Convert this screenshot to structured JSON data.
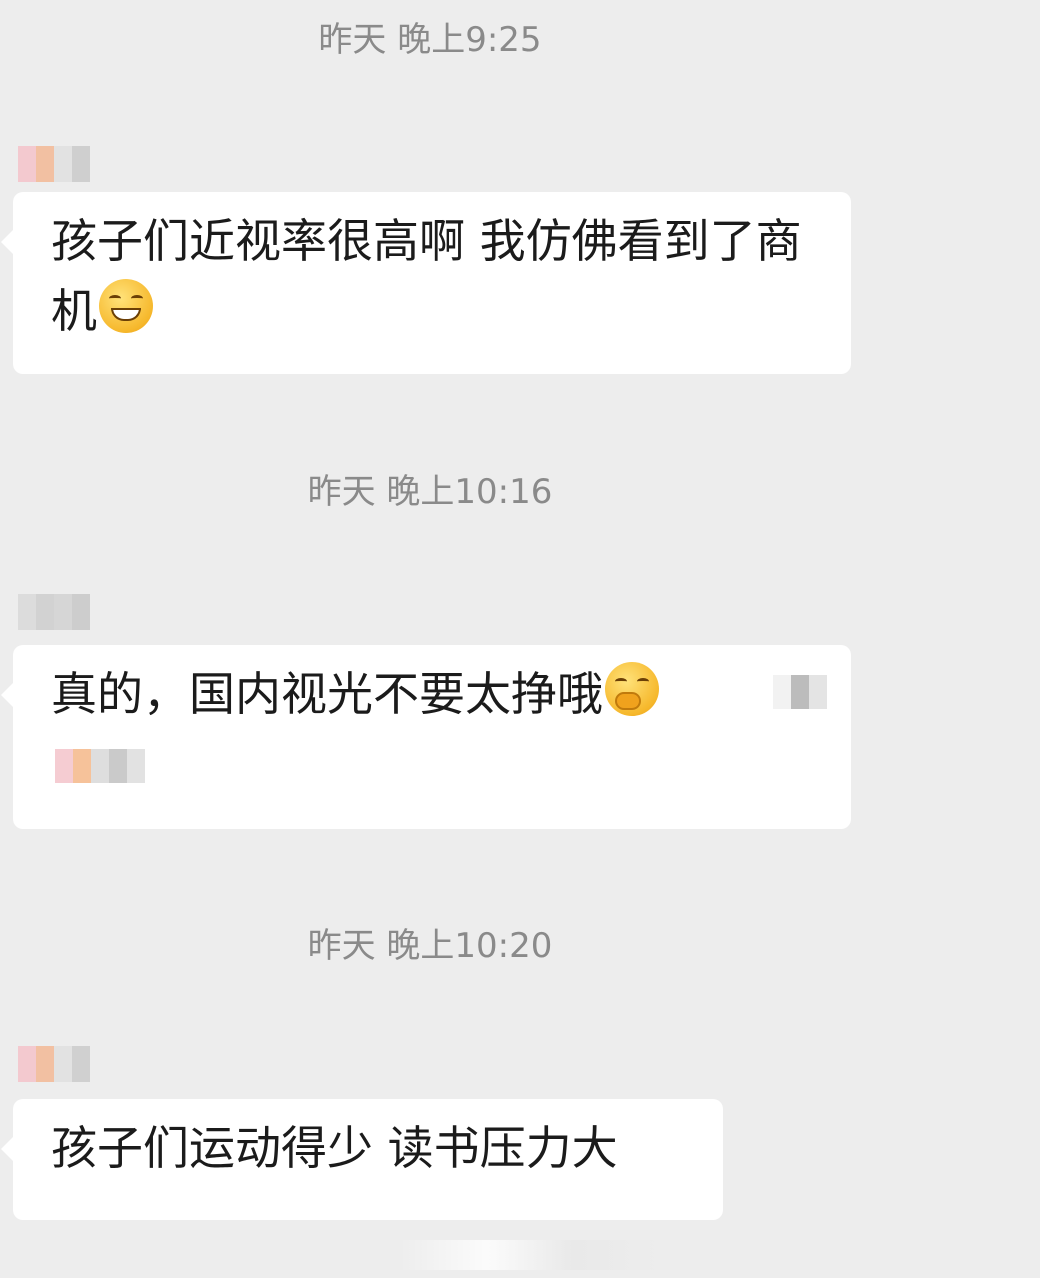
{
  "messages": [
    {
      "timestamp": "昨天 晚上9:25",
      "text": "孩子们近视率很高啊 我仿佛看到了商机",
      "emoji": "grinning-squint-emoji"
    },
    {
      "timestamp": "昨天 晚上10:16",
      "text": "真的，国内视光不要太挣哦",
      "emoji": "hand-over-mouth-emoji"
    },
    {
      "timestamp": "昨天 晚上10:20",
      "text": "孩子们运动得少 读书压力大"
    }
  ],
  "colors": {
    "background": "#ededed",
    "bubble": "#ffffff",
    "text": "#1b1b1b",
    "timestamp": "#8a8a8a"
  }
}
